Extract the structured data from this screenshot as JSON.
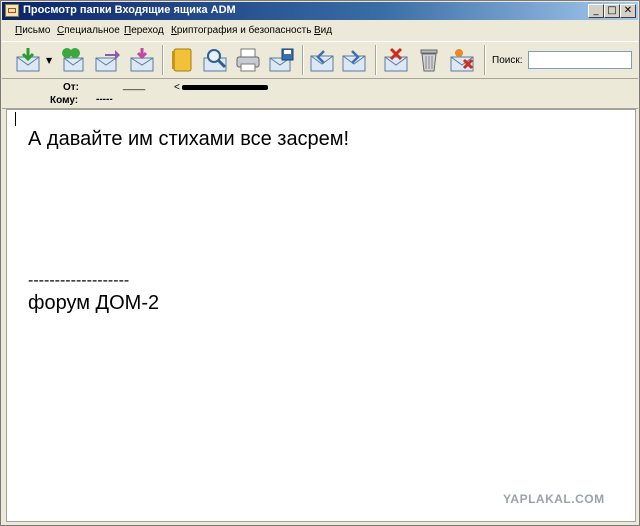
{
  "window": {
    "title": "Просмотр папки Входящие ящика ADM",
    "controls": {
      "minimize": "_",
      "maximize": "□",
      "close": "✕"
    }
  },
  "menu": [
    "Письмо",
    "Специальное",
    "Переход",
    "Криптография и безопасность",
    "Вид"
  ],
  "toolbar": {
    "buttons": [
      {
        "name": "get-mail-icon"
      },
      {
        "name": "reply-all-icon"
      },
      {
        "name": "forward-icon"
      },
      {
        "name": "new-message-icon"
      },
      {
        "name": "address-book-icon"
      },
      {
        "name": "find-icon"
      },
      {
        "name": "print-icon"
      },
      {
        "name": "save-icon"
      },
      {
        "name": "previous-message-icon"
      },
      {
        "name": "next-message-icon"
      },
      {
        "name": "delete-message-icon"
      },
      {
        "name": "trash-icon"
      },
      {
        "name": "mark-junk-icon"
      }
    ],
    "search_label": "Поиск:",
    "search_value": ""
  },
  "header": {
    "from_label": "От:",
    "from_value": "____",
    "from_email_prefix": "<",
    "to_label": "Кому:",
    "to_value": "-----"
  },
  "message": {
    "line1": "А давайте им стихами все засрем!",
    "signature_sep": "-------------------",
    "signature": "форум ДОМ-2"
  },
  "watermark": "YAPLAKAL.COM",
  "colors": {
    "title_start": "#0a246a",
    "title_end": "#a6caf0",
    "chrome": "#ece9d8"
  }
}
